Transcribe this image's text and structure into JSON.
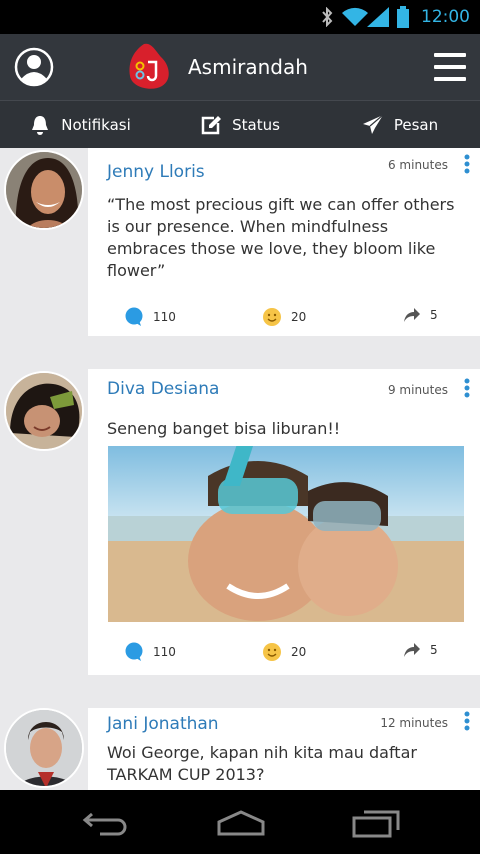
{
  "status_bar": {
    "time": "12:00",
    "icons": [
      "bluetooth-icon",
      "wifi-icon",
      "signal-icon",
      "battery-icon"
    ]
  },
  "app_bar": {
    "title": "Asmirandah",
    "icons": [
      "profile-icon",
      "app-logo",
      "hamburger-menu-icon"
    ]
  },
  "tabs": [
    {
      "label": "Notifikasi",
      "icon": "bell-icon"
    },
    {
      "label": "Status",
      "icon": "edit-icon"
    },
    {
      "label": "Pesan",
      "icon": "paper-plane-icon"
    }
  ],
  "posts": [
    {
      "author": "Jenny Lloris",
      "time": "6 minutes",
      "text": "“The most precious gift we can offer others is our presence. When mindfulness embraces those we love, they bloom like flower”",
      "comments": "110",
      "reactions": "20",
      "shares": "5"
    },
    {
      "author": "Diva Desiana",
      "time": "9 minutes",
      "text": "Seneng banget bisa liburan!!",
      "comments": "110",
      "reactions": "20",
      "shares": "5"
    },
    {
      "author": "Jani Jonathan",
      "time": "12 minutes",
      "text": "Woi George, kapan nih kita mau daftar TARKAM CUP 2013?"
    }
  ],
  "colors": {
    "app_bar": "#33373d",
    "tab_bar": "#2f3338",
    "accent_blue": "#2e7bb8",
    "clock_blue": "#33b5e5",
    "feed_background": "#e9e9eb"
  },
  "nav_bar": {
    "icons": [
      "back-icon",
      "home-icon",
      "recents-icon"
    ]
  }
}
